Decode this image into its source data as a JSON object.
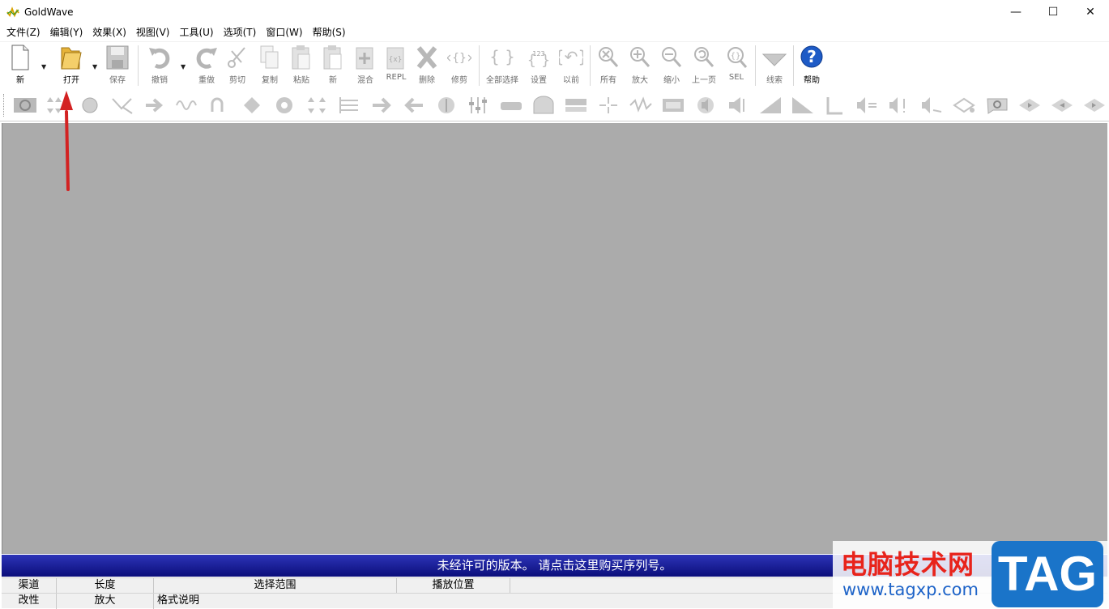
{
  "window": {
    "title": "GoldWave",
    "controls": {
      "minimize": "—",
      "maximize": "☐",
      "close": "✕"
    }
  },
  "menu": [
    "文件(Z)",
    "编辑(Y)",
    "效果(X)",
    "视图(V)",
    "工具(U)",
    "选项(T)",
    "窗口(W)",
    "帮助(S)"
  ],
  "toolbar": {
    "new": "新",
    "open": "打开",
    "save": "保存",
    "undo": "撤销",
    "redo": "重做",
    "cut": "剪切",
    "copy": "复制",
    "paste": "粘贴",
    "paste_new": "新",
    "mix": "混合",
    "replace": "REPL",
    "delete": "删除",
    "trim": "修剪",
    "select_all": "全部选择",
    "set": "设置",
    "previous": "以前",
    "zoom_all": "所有",
    "zoom_in": "放大",
    "zoom_out": "缩小",
    "zoom_prev": "上一页",
    "zoom_sel": "SEL",
    "cue": "线索",
    "help": "帮助"
  },
  "banner": "未经许可的版本。 请点击这里购买序列号。",
  "status": {
    "row1": [
      "渠道",
      "长度",
      "选择范围",
      "播放位置"
    ],
    "row2": [
      "改性",
      "放大",
      "格式说明"
    ]
  },
  "watermark": {
    "cn": "电脑技术网",
    "url": "www.tagxp.com",
    "tag": "TAG"
  },
  "colors": {
    "workspace": "#ababab",
    "banner": "#1a1f9a",
    "annotation_arrow": "#d32222",
    "help_icon": "#1e5bc6"
  }
}
